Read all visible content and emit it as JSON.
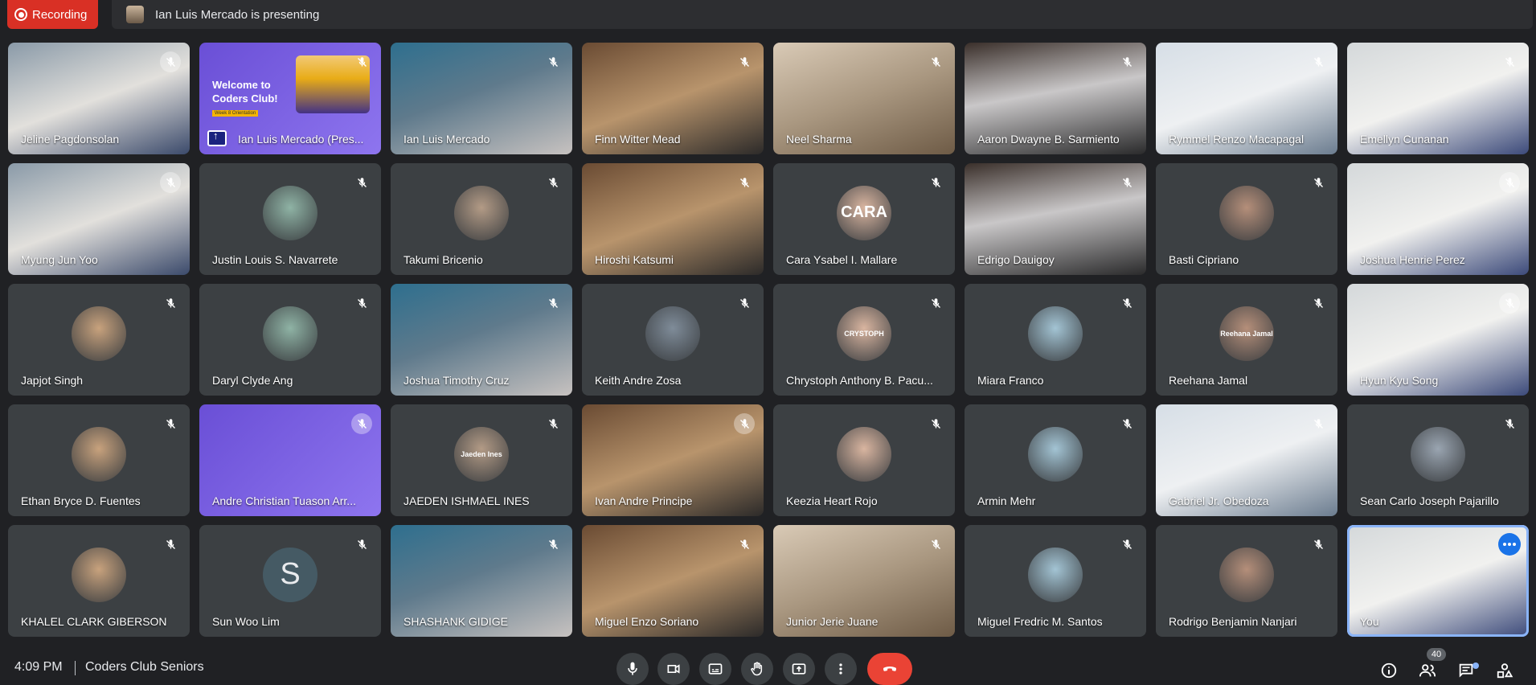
{
  "recording_label": "Recording",
  "presenting_text": "Ian Luis Mercado is presenting",
  "colors": {
    "background": "#202124",
    "tile": "#3c4043",
    "recording": "#d93025",
    "hangup": "#ea4335",
    "self_outline": "#8ab4f8"
  },
  "participants": [
    {
      "name": "Jeline Pagdonsolan",
      "kind": "video"
    },
    {
      "name": "Ian Luis Mercado (Pres...",
      "kind": "presentation",
      "slide_title": "Welcome to Coders Club!",
      "slide_caption": "Week 8 Orientation"
    },
    {
      "name": "Ian Luis Mercado",
      "kind": "video"
    },
    {
      "name": "Finn Witter Mead",
      "kind": "video"
    },
    {
      "name": "Neel Sharma",
      "kind": "video"
    },
    {
      "name": "Aaron Dwayne B. Sarmiento",
      "kind": "video"
    },
    {
      "name": "Rymmel Renzo Macapagal",
      "kind": "video"
    },
    {
      "name": "Emellyn Cunanan",
      "kind": "video"
    },
    {
      "name": "Myung Jun Yoo",
      "kind": "video"
    },
    {
      "name": "Justin Louis S. Navarrete",
      "kind": "avatar"
    },
    {
      "name": "Takumi Bricenio",
      "kind": "avatar"
    },
    {
      "name": "Hiroshi Katsumi",
      "kind": "video"
    },
    {
      "name": "Cara Ysabel I. Mallare",
      "kind": "avatar",
      "avatar_text": "CARA"
    },
    {
      "name": "Edrigo Dauigoy",
      "kind": "video"
    },
    {
      "name": "Basti Cipriano",
      "kind": "avatar"
    },
    {
      "name": "Joshua Henrie Perez",
      "kind": "video"
    },
    {
      "name": "Japjot Singh",
      "kind": "avatar"
    },
    {
      "name": "Daryl Clyde Ang",
      "kind": "avatar"
    },
    {
      "name": "Joshua Timothy Cruz",
      "kind": "video"
    },
    {
      "name": "Keith Andre Zosa",
      "kind": "avatar"
    },
    {
      "name": "Chrystoph Anthony B. Pacu...",
      "kind": "avatar",
      "avatar_text": "CRYSTOPH"
    },
    {
      "name": "Miara Franco",
      "kind": "avatar"
    },
    {
      "name": "Reehana Jamal",
      "kind": "avatar",
      "avatar_text": "Reehana Jamal"
    },
    {
      "name": "Hyun Kyu Song",
      "kind": "video"
    },
    {
      "name": "Ethan Bryce D. Fuentes",
      "kind": "avatar"
    },
    {
      "name": "Andre Christian Tuason Arr...",
      "kind": "video"
    },
    {
      "name": "JAEDEN ISHMAEL INES",
      "kind": "avatar",
      "avatar_text": "Jaeden Ines"
    },
    {
      "name": "Ivan Andre Principe",
      "kind": "video"
    },
    {
      "name": "Keezia Heart Rojo",
      "kind": "avatar"
    },
    {
      "name": "Armin Mehr",
      "kind": "avatar"
    },
    {
      "name": "Gabriel Jr. Obedoza",
      "kind": "video"
    },
    {
      "name": "Sean Carlo Joseph Pajarillo",
      "kind": "avatar"
    },
    {
      "name": "KHALEL CLARK GIBERSON",
      "kind": "avatar"
    },
    {
      "name": "Sun Woo Lim",
      "kind": "letter",
      "avatar_text": "S"
    },
    {
      "name": "SHASHANK GIDIGE",
      "kind": "video"
    },
    {
      "name": "Miguel Enzo Soriano",
      "kind": "video"
    },
    {
      "name": "Junior Jerie Juane",
      "kind": "video"
    },
    {
      "name": "Miguel Fredric M. Santos",
      "kind": "avatar"
    },
    {
      "name": "Rodrigo Benjamin Nanjari",
      "kind": "avatar"
    },
    {
      "name": "You",
      "kind": "self"
    }
  ],
  "bottom": {
    "time": "4:09 PM",
    "meeting_name": "Coders Club Seniors",
    "participant_count": "40"
  }
}
